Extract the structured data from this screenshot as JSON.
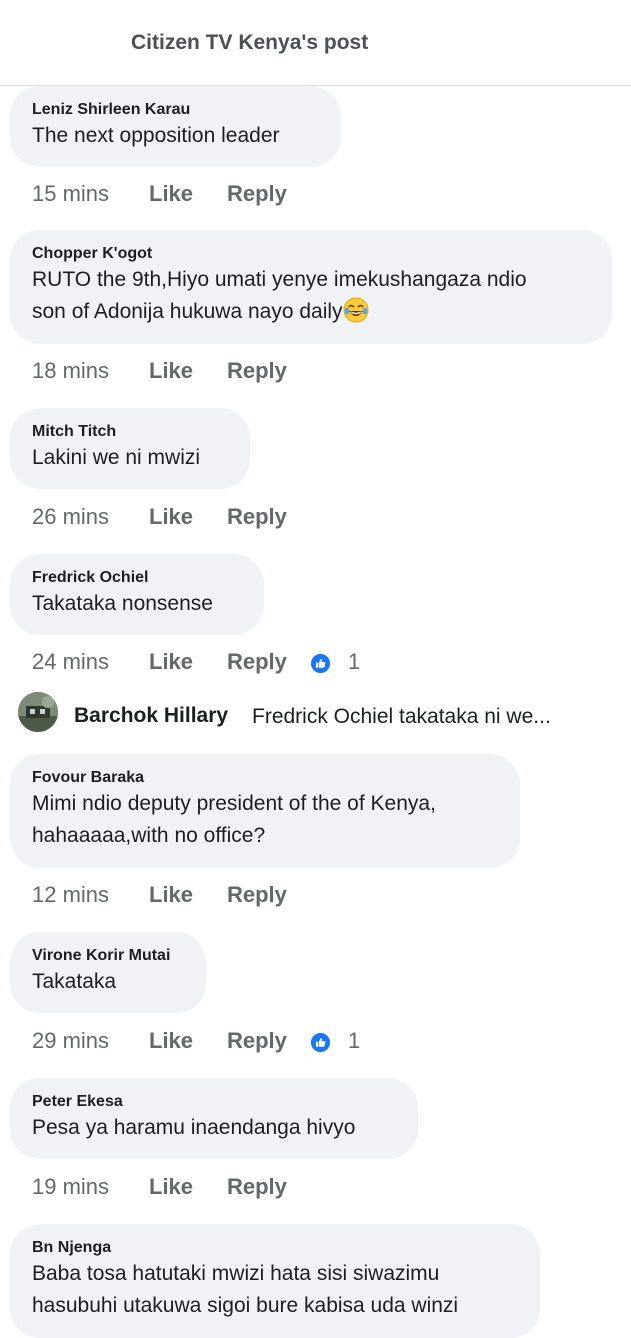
{
  "header": {
    "title": "Citizen TV Kenya's post"
  },
  "actions": {
    "like_label": "Like",
    "reply_label": "Reply"
  },
  "comments": [
    {
      "author": "Leniz Shirleen Karau",
      "lines": [
        "The next opposition leader"
      ],
      "time": "15 mins"
    },
    {
      "author": "Chopper K'ogot",
      "lines": [
        "RUTO the 9th,Hiyo umati yenye imekushangaza ndio",
        "son of Adonija hukuwa nayo daily"
      ],
      "emoji": "face-with-tears-of-joy",
      "time": "18 mins"
    },
    {
      "author": "Mitch Titch",
      "lines": [
        "Lakini we ni mwizi"
      ],
      "time": "26 mins"
    },
    {
      "author": "Fredrick Ochiel",
      "lines": [
        "Takataka nonsense"
      ],
      "time": "24 mins",
      "reactions": "1",
      "reaction_icon": "like-reaction-icon"
    },
    {
      "author": "Fovour Baraka",
      "lines": [
        "Mimi ndio deputy president of the of Kenya,",
        "hahaaaaa,with no office?"
      ],
      "time": "12 mins"
    },
    {
      "author": "Virone Korir Mutai",
      "lines": [
        "Takataka"
      ],
      "time": "29 mins",
      "reactions": "1",
      "reaction_icon": "like-reaction-icon"
    },
    {
      "author": "Peter Ekesa",
      "lines": [
        "Pesa ya haramu inaendanga hivyo"
      ],
      "time": "19 mins"
    },
    {
      "author": "Bn Njenga",
      "lines": [
        "Baba tosa hatutaki mwizi hata sisi siwazimu",
        "hasubuhi utakuwa sigoi bure kabisa uda winzi"
      ]
    }
  ],
  "reply_preview": {
    "author": "Barchok Hillary",
    "text": "Fredrick Ochiel takataka ni we..."
  },
  "colors": {
    "like_blue": "#1877f2",
    "bubble_bg": "#f0f2f5",
    "meta_gray": "#65676b"
  }
}
